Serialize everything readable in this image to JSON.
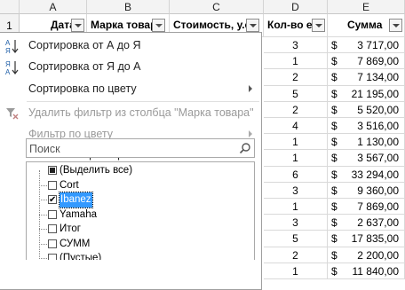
{
  "columns": {
    "rowhdr": "",
    "A": "A",
    "B": "B",
    "C": "C",
    "D": "D",
    "E": "E"
  },
  "header_row": {
    "num": "1",
    "date": "Дата",
    "brand": "Марка товара",
    "cost": "Стоимость, у.е.",
    "qty": "Кол-во е",
    "sum": "Сумма"
  },
  "rows": [
    {
      "qty": "3",
      "cur": "$",
      "sum": "3 717,00"
    },
    {
      "qty": "1",
      "cur": "$",
      "sum": "7 869,00"
    },
    {
      "qty": "2",
      "cur": "$",
      "sum": "7 134,00"
    },
    {
      "qty": "5",
      "cur": "$",
      "sum": "21 195,00"
    },
    {
      "qty": "2",
      "cur": "$",
      "sum": "5 520,00"
    },
    {
      "qty": "4",
      "cur": "$",
      "sum": "3 516,00"
    },
    {
      "qty": "1",
      "cur": "$",
      "sum": "1 130,00"
    },
    {
      "qty": "1",
      "cur": "$",
      "sum": "3 567,00"
    },
    {
      "qty": "6",
      "cur": "$",
      "sum": "33 294,00"
    },
    {
      "qty": "3",
      "cur": "$",
      "sum": "9 360,00"
    },
    {
      "qty": "1",
      "cur": "$",
      "sum": "7 869,00"
    },
    {
      "qty": "3",
      "cur": "$",
      "sum": "2 637,00"
    },
    {
      "qty": "5",
      "cur": "$",
      "sum": "17 835,00"
    },
    {
      "qty": "2",
      "cur": "$",
      "sum": "2 200,00"
    },
    {
      "qty": "1",
      "cur": "$",
      "sum": "11 840,00"
    }
  ],
  "menu": {
    "sort_asc": "Сортировка от А до Я",
    "sort_desc": "Сортировка от Я до А",
    "sort_color": "Сортировка по цвету",
    "clear_filter": "Удалить фильтр из столбца \"Марка товара\"",
    "filter_color": "Фильтр по цвету",
    "text_filters": "Текстовые фильтры",
    "search_placeholder": "Поиск",
    "items": [
      {
        "label": "(Выделить все)",
        "state": "partial"
      },
      {
        "label": "Cort",
        "state": "unchecked"
      },
      {
        "label": "Ibanez",
        "state": "checked"
      },
      {
        "label": "Yamaha",
        "state": "unchecked"
      },
      {
        "label": "Итог",
        "state": "unchecked"
      },
      {
        "label": "СУММ",
        "state": "unchecked"
      },
      {
        "label": "(Пустые)",
        "state": "unchecked"
      }
    ]
  },
  "colors": {
    "selection": "#3399ff",
    "header_bg": "#f3f3f3"
  }
}
